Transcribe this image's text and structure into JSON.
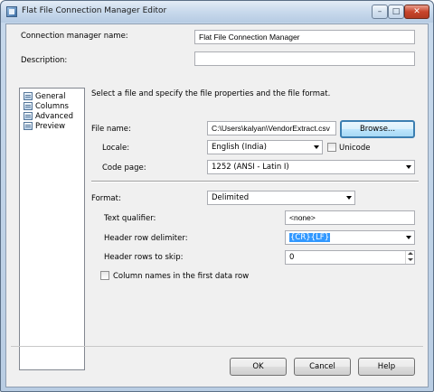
{
  "window": {
    "title": "Flat File Connection Manager Editor",
    "controls": {
      "minimize": "–",
      "maximize": "□",
      "close": "✕"
    }
  },
  "header": {
    "name_label": "Connection manager name:",
    "name_value": "Flat File Connection Manager",
    "description_label": "Description:",
    "description_value": ""
  },
  "nav": {
    "items": [
      {
        "label": "General",
        "selected": true
      },
      {
        "label": "Columns"
      },
      {
        "label": "Advanced"
      },
      {
        "label": "Preview"
      }
    ]
  },
  "general": {
    "intro": "Select a file and specify the file properties and the file format.",
    "file_name_label": "File name:",
    "file_name_value": "C:\\Users\\kalyan\\VendorExtract.csv",
    "browse_label": "Browse...",
    "locale_label": "Locale:",
    "locale_value": "English (India)",
    "unicode_label": "Unicode",
    "unicode_checked": false,
    "code_page_label": "Code page:",
    "code_page_value": "1252  (ANSI - Latin I)",
    "format_label": "Format:",
    "format_value": "Delimited",
    "text_qualifier_label": "Text qualifier:",
    "text_qualifier_value": "<none>",
    "header_row_delimiter_label": "Header row delimiter:",
    "header_row_delimiter_value": "{CR}{LF}",
    "header_rows_to_skip_label": "Header rows to skip:",
    "header_rows_to_skip_value": "0",
    "column_names_label": "Column names in the first data row",
    "column_names_checked": false
  },
  "footer": {
    "ok_label": "OK",
    "cancel_label": "Cancel",
    "help_label": "Help"
  },
  "colors": {
    "selection": "#3399ff",
    "browse_border": "#3c7fb1",
    "close_button": "#c8452c"
  }
}
